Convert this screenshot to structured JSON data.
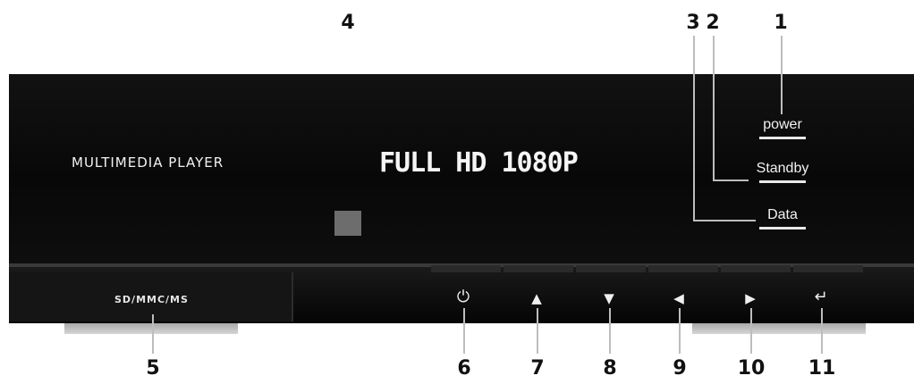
{
  "device": {
    "brand_label": "MULTIMEDIA PLAYER",
    "hd_label": "FULL HD 1080P",
    "card_slot_label": "SD/MMC/MS"
  },
  "indicators": {
    "power": "power",
    "standby": "Standby",
    "data": "Data"
  },
  "buttons": {
    "power_icon": "power-icon",
    "up_icon": "up-arrow-icon",
    "down_icon": "down-arrow-icon",
    "left_icon": "left-arrow-icon",
    "right_icon": "right-arrow-icon",
    "enter_icon": "enter-icon"
  },
  "callouts": {
    "c1": "1",
    "c2": "2",
    "c3": "3",
    "c4": "4",
    "c5": "5",
    "c6": "6",
    "c7": "7",
    "c8": "8",
    "c9": "9",
    "c10": "10",
    "c11": "11"
  }
}
